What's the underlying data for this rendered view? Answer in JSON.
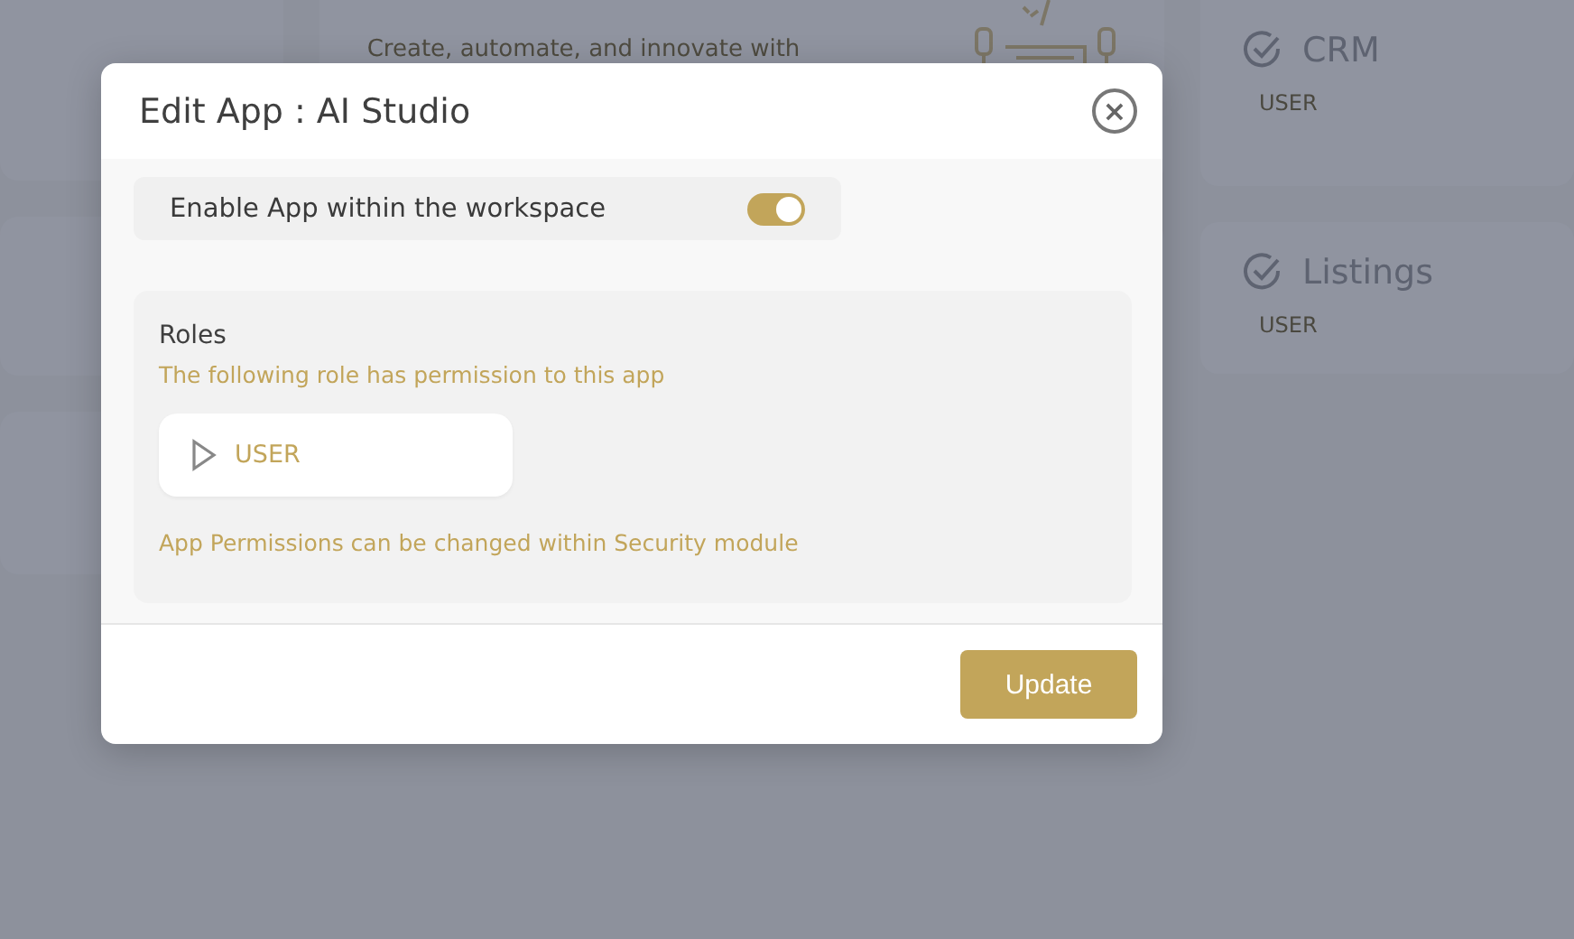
{
  "background": {
    "cards": [
      {
        "kind": "app",
        "description": "Create, automate, and innovate with"
      },
      {
        "kind": "role",
        "title": "CRM",
        "role": "USER"
      },
      {
        "kind": "role",
        "title": "Listings",
        "role": "USER"
      }
    ]
  },
  "dialog": {
    "title": "Edit App : AI Studio",
    "close": "×",
    "enable": {
      "label": "Enable App within the workspace",
      "on": true
    },
    "roles": {
      "heading": "Roles",
      "note": "The following role has permission to this app",
      "items": [
        {
          "name": "USER"
        }
      ],
      "footnote": "App Permissions can be changed within Security module"
    },
    "buttons": [
      {
        "label": "Update"
      }
    ]
  }
}
